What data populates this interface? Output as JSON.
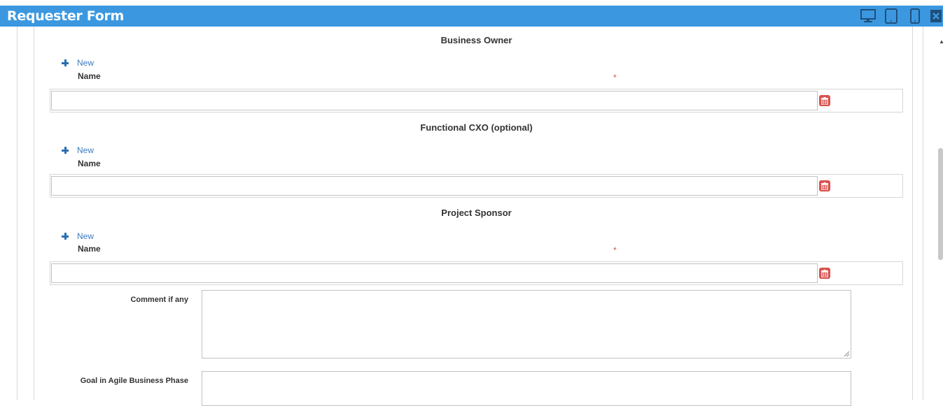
{
  "window": {
    "title": "Requester Form"
  },
  "toolbar": {
    "desktop_icon": "desktop-icon",
    "tablet_icon": "tablet-icon",
    "phone_icon": "phone-icon",
    "close_icon": "close-icon"
  },
  "sections": [
    {
      "title": "Business Owner",
      "new_label": "New",
      "name_label": "Name",
      "required_mark": "*",
      "value": ""
    },
    {
      "title": "Functional CXO (optional)",
      "new_label": "New",
      "name_label": "Name",
      "required_mark": "",
      "value": ""
    },
    {
      "title": "Project Sponsor",
      "new_label": "New",
      "name_label": "Name",
      "required_mark": "*",
      "value": ""
    }
  ],
  "fields": {
    "comment": {
      "label": "Comment if any",
      "value": ""
    },
    "goal": {
      "label": "Goal in Agile Business Phase",
      "value": ""
    }
  },
  "colors": {
    "titlebar": "#3b98e0",
    "accent": "#3a7bc0",
    "danger": "#d9534f"
  }
}
